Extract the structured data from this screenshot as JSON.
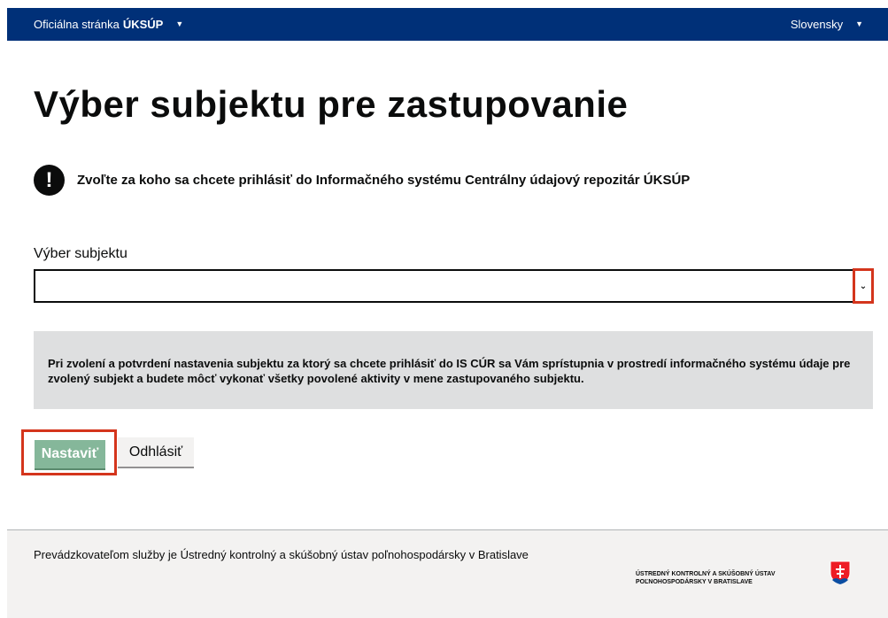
{
  "topbar": {
    "official_text": "Oficiálna stránka",
    "brand": "ÚKSÚP",
    "language": "Slovensky",
    "caret": "▼"
  },
  "page_title": "Výber subjektu pre zastupovanie",
  "warning": {
    "icon": "exclamation-icon",
    "glyph": "!",
    "text": "Zvoľte za koho sa chcete prihlásiť do Informačného systému Centrálny údajový repozitár ÚKSÚP"
  },
  "select": {
    "label": "Výber subjektu",
    "value": "",
    "chevron": "⌄"
  },
  "info_text": "Pri zvolení a potvrdení nastavenia subjektu za ktorý sa chcete prihlásiť do IS CÚR sa Vám sprístupnia v prostredí informačného systému údaje pre zvolený subjekt a budete môcť vykonať všetky povolené aktivity v mene zastupovaného subjektu.",
  "buttons": {
    "set": "Nastaviť",
    "logout": "Odhlásiť"
  },
  "footer": {
    "text": "Prevádzkovateľom služby je Ústredný kontrolný a skúšobný ústav poľnohospodársky v Bratislave",
    "org_line1": "ÚSTREDNÝ KONTROLNÝ A SKÚŠOBNÝ ÚSTAV",
    "org_line2": "POĽNOHOSPODÁRSKY V BRATISLAVE",
    "emblem": "slovak-coat-of-arms-icon"
  },
  "colors": {
    "topbar": "#003078",
    "primary_button": "#85b79a",
    "highlight": "#d4351c",
    "info_bg": "#dedfe0"
  }
}
